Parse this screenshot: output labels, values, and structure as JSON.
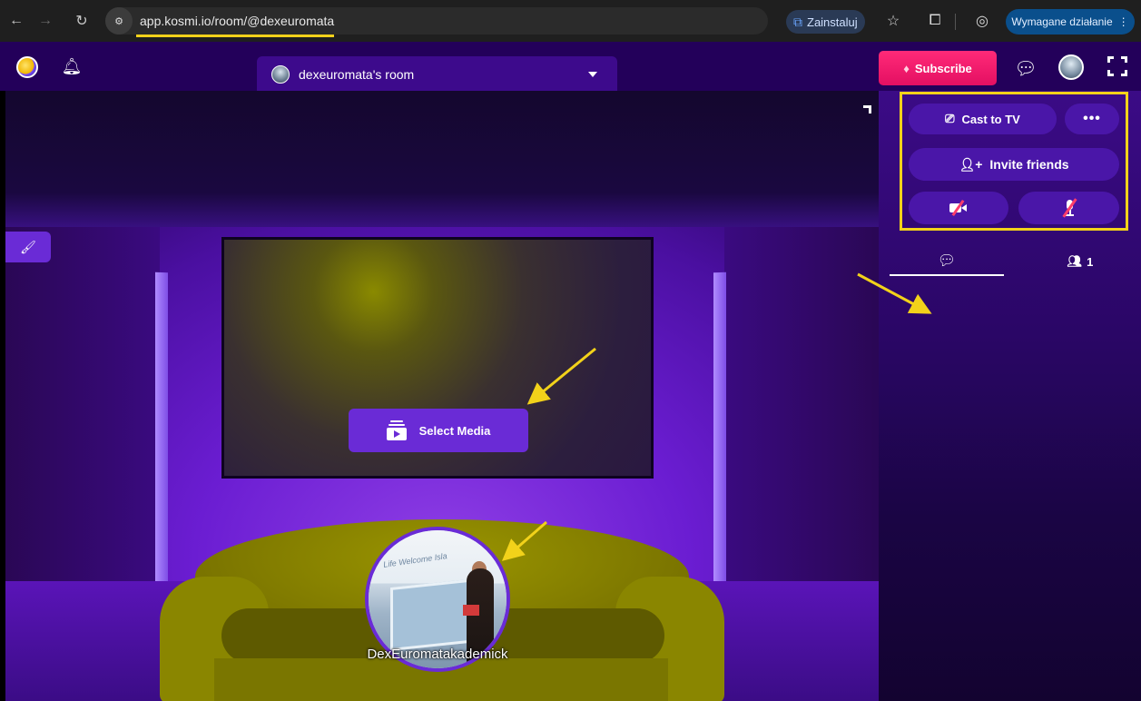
{
  "browser": {
    "url": "app.kosmi.io/room/@dexeuromata",
    "install_label": "Zainstaluj",
    "action_label": "Wymagane działanie",
    "icons": [
      "back-icon",
      "forward-icon",
      "reload-icon",
      "site-info-icon",
      "bookmark-star-icon",
      "extensions-icon",
      "profile-icon",
      "menu-icon"
    ]
  },
  "app": {
    "room_name": "dexeuromata's room",
    "subscribe_label": "Subscribe",
    "icons": [
      "kosmi-logo-icon",
      "bell-icon",
      "chat-bubble-icon",
      "fullscreen-icon"
    ]
  },
  "stage": {
    "select_media_label": "Select Media",
    "member_name": "DexEuromatakademick",
    "member_photo_text": "Life Welcome Isla"
  },
  "panel": {
    "cast_label": "Cast to TV",
    "more_label": "•••",
    "invite_label": "Invite friends",
    "member_count": "1",
    "icons": [
      "cast-icon",
      "more-icon",
      "add-user-icon",
      "camera-off-icon",
      "mic-off-icon",
      "chat-tab-icon",
      "members-icon"
    ]
  },
  "colors": {
    "annotation_yellow": "#f2d21a",
    "accent_purple": "#6a2bd6",
    "subscribe_pink": "#ff2a78",
    "couch_olive": "#8a8600"
  }
}
